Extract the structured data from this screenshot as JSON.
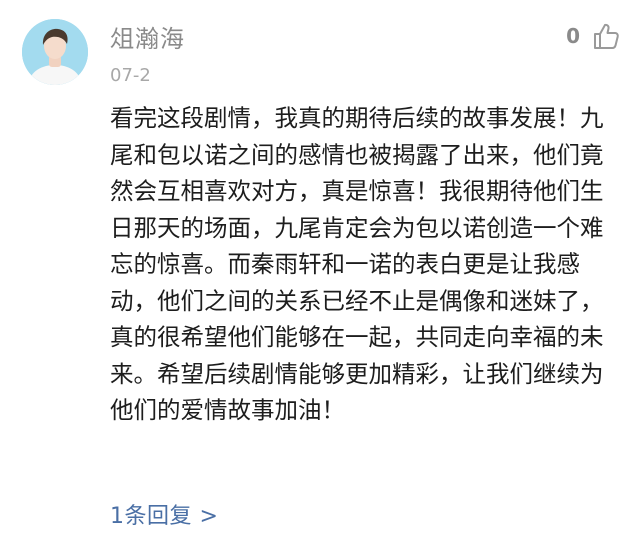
{
  "comment": {
    "username": "俎瀚海",
    "date": "07-2",
    "like_count": "0",
    "content": "看完这段剧情，我真的期待后续的故事发展！九尾和包以诺之间的感情也被揭露了出来，他们竟然会互相喜欢对方，真是惊喜！我很期待他们生日那天的场面，九尾肯定会为包以诺创造一个难忘的惊喜。而秦雨轩和一诺的表白更是让我感动，他们之间的关系已经不止是偶像和迷妹了，真的很希望他们能够在一起，共同走向幸福的未来。希望后续剧情能够更加精彩，让我们继续为他们的爱情故事加油！",
    "replies_label": "1条回复 >"
  },
  "icons": {
    "like": "thumbs-up-icon"
  },
  "colors": {
    "username": "#8a8a8a",
    "content": "#1d1d1d",
    "replies_link": "#4a6fa5",
    "avatar_bg": "#9fd8ec"
  }
}
